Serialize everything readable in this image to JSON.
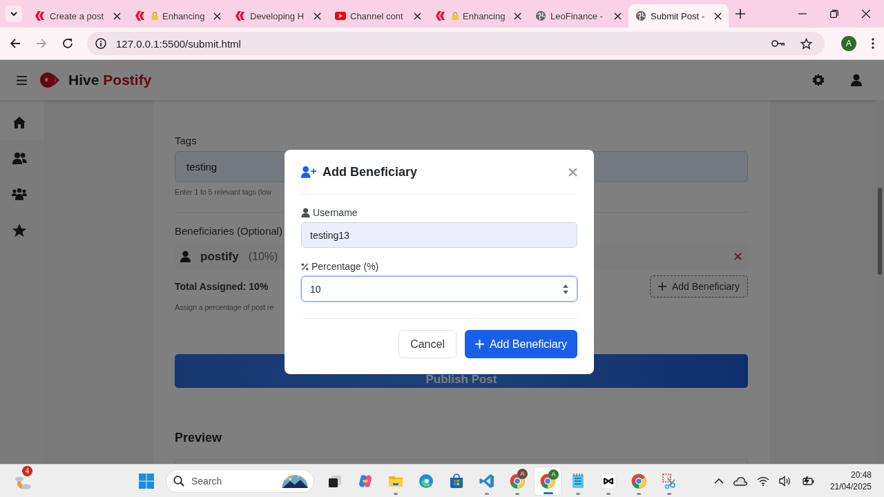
{
  "browser": {
    "tabs": [
      {
        "title": "Create a post",
        "kind": "hive",
        "locked": false,
        "selected": false
      },
      {
        "title": "Enhancing",
        "kind": "hive",
        "locked": true,
        "selected": false
      },
      {
        "title": "Developing H",
        "kind": "hive",
        "locked": false,
        "selected": false
      },
      {
        "title": "Channel cont",
        "kind": "youtube",
        "locked": false,
        "selected": false
      },
      {
        "title": "Enhancing",
        "kind": "hive",
        "locked": true,
        "selected": false
      },
      {
        "title": "LeoFinance -",
        "kind": "globe",
        "locked": false,
        "selected": false
      },
      {
        "title": "Submit Post -",
        "kind": "globe",
        "locked": false,
        "selected": true
      }
    ],
    "url": "127.0.0.1:5500/submit.html",
    "profile_initial": "A"
  },
  "app": {
    "brand": {
      "name": "Hive",
      "accent": "Postify"
    },
    "sidebar": {
      "items": [
        {
          "kind": "home",
          "selected": true
        },
        {
          "kind": "users",
          "selected": false
        },
        {
          "kind": "group",
          "selected": false
        },
        {
          "kind": "star",
          "selected": false
        }
      ]
    }
  },
  "form": {
    "tags": {
      "label": "Tags",
      "value": "testing",
      "hint": "Enter 1 to 5 relevant tags (low"
    },
    "beneficiaries": {
      "label": "Beneficiaries (Optional)",
      "items": [
        {
          "username": "postify",
          "percent": "(10%)"
        }
      ],
      "total": "Total Assigned: 10%",
      "add_button": "Add Beneficiary",
      "hint": "Assign a percentage of post re"
    },
    "publish_button": "Publish Post",
    "preview_heading": "Preview"
  },
  "dialog": {
    "title": "Add Beneficiary",
    "fields": [
      {
        "label": "Username",
        "kind": "text",
        "value": "testing13",
        "autofilled": true,
        "focused": false
      },
      {
        "label": "Percentage (%)",
        "kind": "number",
        "value": "10",
        "autofilled": false,
        "focused": true
      }
    ],
    "buttons": [
      {
        "label": "Cancel",
        "kind": "secondary"
      },
      {
        "label": "Add Beneficiary",
        "kind": "primary"
      }
    ]
  },
  "taskbar": {
    "weather_badge": "4",
    "search": {
      "placeholder": "Search"
    },
    "apps": [
      {
        "kind": "taskview",
        "running": false,
        "selected": false
      },
      {
        "kind": "copilot",
        "running": false,
        "selected": false
      },
      {
        "kind": "files",
        "running": true,
        "selected": false
      },
      {
        "kind": "edge",
        "running": false,
        "selected": false
      },
      {
        "kind": "store",
        "running": false,
        "selected": false
      },
      {
        "kind": "vscode",
        "running": true,
        "selected": false
      },
      {
        "kind": "chrome",
        "running": true,
        "selected": false,
        "badge": "A",
        "color": "#6d4c41"
      },
      {
        "kind": "chrome",
        "running": true,
        "selected": true,
        "badge": "A",
        "color": "#2e7d32"
      },
      {
        "kind": "notepad",
        "running": true,
        "selected": false
      },
      {
        "kind": "capcut",
        "running": true,
        "selected": false
      },
      {
        "kind": "chrome",
        "running": true,
        "selected": false
      },
      {
        "kind": "snip",
        "running": true,
        "selected": false
      }
    ],
    "clock": {
      "time": "20:48",
      "date": "21/04/2025"
    }
  }
}
